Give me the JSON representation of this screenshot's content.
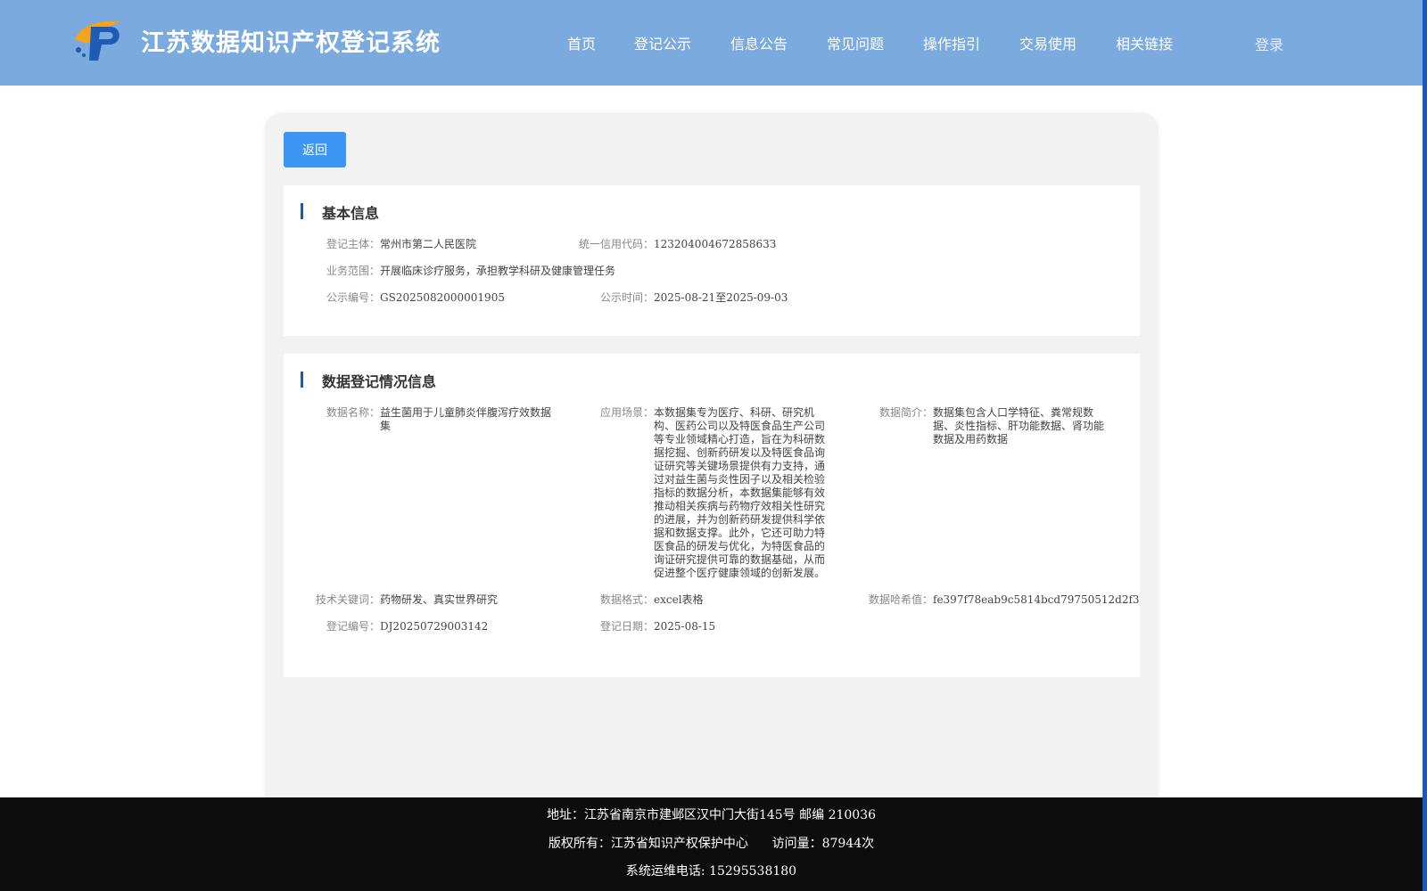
{
  "header": {
    "title": "江苏数据知识产权登记系统",
    "nav": [
      "首页",
      "登记公示",
      "信息公告",
      "常见问题",
      "操作指引",
      "交易使用",
      "相关链接"
    ],
    "login": "登录"
  },
  "back_label": "返回",
  "basic": {
    "title": "基本信息",
    "subject_label": "登记主体：",
    "subject": "常州市第二人民医院",
    "credit_label": "统一信用代码：",
    "credit": "12320400467285863З",
    "scope_label": "业务范围：",
    "scope": "开展临床诊疗服务，承担教学科研及健康管理任务",
    "notice_no_label": "公示编号：",
    "notice_no": "GS2025082000001905",
    "notice_time_label": "公示时间：",
    "notice_time": "2025-08-21至2025-09-03"
  },
  "data_info": {
    "title": "数据登记情况信息",
    "name_label": "数据名称：",
    "name": "益生菌用于儿童肺炎伴腹泻疗效数据集",
    "scene_label": "应用场景：",
    "scene": "本数据集专为医疗、科研、研究机构、医药公司以及特医食品生产公司等专业领域精心打造，旨在为科研数据挖掘、创新药研发以及特医食品询证研究等关键场景提供有力支持，通过对益生菌与炎性因子以及相关检验指标的数据分析，本数据集能够有效推动相关疾病与药物疗效相关性研究的进展，并为创新药研发提供科学依据和数据支撑。此外，它还可助力特医食品的研发与优化，为特医食品的询证研究提供可靠的数据基础，从而促进整个医疗健康领域的创新发展。",
    "brief_label": "数据简介：",
    "brief": "数据集包含人口学特征、粪常规数据、炎性指标、肝功能数据、肾功能数据及用药数据",
    "keywords_label": "技术关键词：",
    "keywords": "药物研发、真实世界研究",
    "format_label": "数据格式：",
    "format": "excel表格",
    "hash_label": "数据哈希值：",
    "hash": "fe397f78eab9c5814bcd79750512d2f3",
    "reg_no_label": "登记编号：",
    "reg_no": "DJ20250729003142",
    "reg_date_label": "登记日期：",
    "reg_date": "2025-08-15"
  },
  "footer": {
    "address": "地址：江苏省南京市建邺区汉中门大街145号 邮编 210036",
    "copyright": "版权所有：江苏省知识产权保护中心      访问量：87944次",
    "phone": "系统运维电话: 15295538180"
  },
  "colors": {
    "header_bg": "#7aaade",
    "button": "#3d96f4",
    "title_bar": "#1f5aa8",
    "footer_bg": "#0d0d0d"
  }
}
